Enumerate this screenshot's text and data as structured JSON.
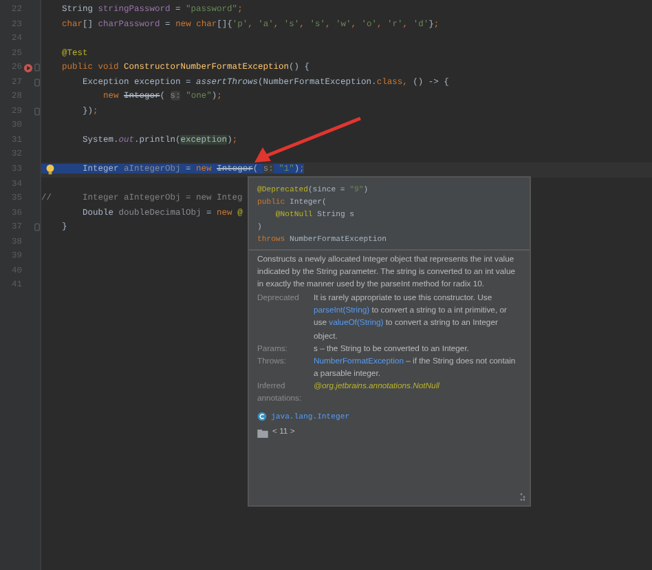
{
  "editor": {
    "lines": [
      {
        "number": "22",
        "selected": false,
        "fold": false,
        "run_icon": false,
        "bulb_icon": false,
        "tokens": [
          {
            "kind": "plain",
            "text": "    String "
          },
          {
            "kind": "field",
            "text": "stringPassword"
          },
          {
            "kind": "plain",
            "text": " = "
          },
          {
            "kind": "str",
            "text": "\"password\""
          },
          {
            "kind": "kw",
            "text": ";"
          }
        ]
      },
      {
        "number": "23",
        "selected": false,
        "fold": false,
        "run_icon": false,
        "bulb_icon": false,
        "tokens": [
          {
            "kind": "kw",
            "text": "    char"
          },
          {
            "kind": "plain",
            "text": "[] "
          },
          {
            "kind": "field",
            "text": "charPassword"
          },
          {
            "kind": "plain",
            "text": " = "
          },
          {
            "kind": "kw",
            "text": "new char"
          },
          {
            "kind": "plain",
            "text": "[]{"
          },
          {
            "kind": "str",
            "text": "'p'"
          },
          {
            "kind": "kw",
            "text": ", "
          },
          {
            "kind": "str",
            "text": "'a'"
          },
          {
            "kind": "kw",
            "text": ", "
          },
          {
            "kind": "str",
            "text": "'s'"
          },
          {
            "kind": "kw",
            "text": ", "
          },
          {
            "kind": "str",
            "text": "'s'"
          },
          {
            "kind": "kw",
            "text": ", "
          },
          {
            "kind": "str",
            "text": "'w'"
          },
          {
            "kind": "kw",
            "text": ", "
          },
          {
            "kind": "str",
            "text": "'o'"
          },
          {
            "kind": "kw",
            "text": ", "
          },
          {
            "kind": "str",
            "text": "'r'"
          },
          {
            "kind": "kw",
            "text": ", "
          },
          {
            "kind": "str",
            "text": "'d'"
          },
          {
            "kind": "plain",
            "text": "}"
          },
          {
            "kind": "kw",
            "text": ";"
          }
        ]
      },
      {
        "number": "24",
        "selected": false,
        "fold": false,
        "run_icon": false,
        "bulb_icon": false
      },
      {
        "number": "25",
        "selected": false,
        "fold": false,
        "run_icon": false,
        "bulb_icon": false,
        "tokens": [
          {
            "kind": "ann",
            "text": "    @Test"
          }
        ]
      },
      {
        "number": "26",
        "selected": false,
        "fold": true,
        "run_icon": true,
        "bulb_icon": false,
        "tokens": [
          {
            "kind": "kw",
            "text": "    public void "
          },
          {
            "kind": "decl",
            "text": "ConstructorNumberFormatException"
          },
          {
            "kind": "plain",
            "text": "() {"
          }
        ]
      },
      {
        "number": "27",
        "selected": false,
        "fold": true,
        "run_icon": false,
        "bulb_icon": false,
        "tokens": [
          {
            "kind": "plain",
            "text": "        Exception exception = "
          },
          {
            "kind": "italic",
            "text": "assertThrows"
          },
          {
            "kind": "plain",
            "text": "(NumberFormatException."
          },
          {
            "kind": "kw",
            "text": "class, "
          },
          {
            "kind": "plain",
            "text": "() -> {"
          }
        ]
      },
      {
        "number": "28",
        "selected": false,
        "fold": false,
        "run_icon": false,
        "bulb_icon": false,
        "tokens": [
          {
            "kind": "kw",
            "text": "            new "
          },
          {
            "kind": "deprecated",
            "text": "Integer"
          },
          {
            "kind": "plain",
            "text": "( "
          },
          {
            "kind": "hint",
            "text": "s:"
          },
          {
            "kind": "str",
            "text": " \"one\""
          },
          {
            "kind": "plain",
            "text": ")"
          },
          {
            "kind": "kw",
            "text": ";"
          }
        ]
      },
      {
        "number": "29",
        "selected": false,
        "fold": true,
        "run_icon": false,
        "bulb_icon": false,
        "tokens": [
          {
            "kind": "plain",
            "text": "        })"
          },
          {
            "kind": "kw",
            "text": ";"
          }
        ]
      },
      {
        "number": "30",
        "selected": false,
        "fold": false,
        "run_icon": false,
        "bulb_icon": false
      },
      {
        "number": "31",
        "selected": false,
        "fold": false,
        "run_icon": false,
        "bulb_icon": false,
        "tokens": [
          {
            "kind": "plain",
            "text": "        System."
          },
          {
            "kind": "static",
            "text": "out"
          },
          {
            "kind": "plain",
            "text": ".println("
          },
          {
            "kind": "usage",
            "text": "exception"
          },
          {
            "kind": "plain",
            "text": ")"
          },
          {
            "kind": "kw",
            "text": ";"
          }
        ]
      },
      {
        "number": "32",
        "selected": false,
        "fold": false,
        "run_icon": false,
        "bulb_icon": false
      },
      {
        "number": "33",
        "selected": true,
        "fold": false,
        "run_icon": false,
        "bulb_icon": true,
        "tokens": [
          {
            "kind": "plain",
            "text": "        Integer "
          },
          {
            "kind": "unused",
            "text": "aIntegerObj"
          },
          {
            "kind": "plain",
            "text": " = "
          },
          {
            "kind": "kw",
            "text": "new "
          },
          {
            "kind": "deprecated",
            "text": "Integer"
          },
          {
            "kind": "plain",
            "text": "( "
          },
          {
            "kind": "hint",
            "text": "s:"
          },
          {
            "kind": "str",
            "text": " \"1\""
          },
          {
            "kind": "plain",
            "text": ")"
          },
          {
            "kind": "kw",
            "text": ";"
          }
        ]
      },
      {
        "number": "34",
        "selected": false,
        "fold": false,
        "run_icon": false,
        "bulb_icon": false
      },
      {
        "number": "35",
        "selected": false,
        "fold": false,
        "run_icon": false,
        "bulb_icon": false,
        "tokens": [
          {
            "kind": "comment",
            "text": "//      Integer aIntegerObj = new Integ"
          }
        ]
      },
      {
        "number": "36",
        "selected": false,
        "fold": false,
        "run_icon": false,
        "bulb_icon": false,
        "tokens": [
          {
            "kind": "plain",
            "text": "        Double "
          },
          {
            "kind": "unused",
            "text": "doubleDecimalObj"
          },
          {
            "kind": "plain",
            "text": " = "
          },
          {
            "kind": "kw",
            "text": "new "
          },
          {
            "kind": "ann",
            "text": "@"
          }
        ]
      },
      {
        "number": "37",
        "selected": false,
        "fold": true,
        "run_icon": false,
        "bulb_icon": false,
        "tokens": [
          {
            "kind": "plain",
            "text": "    }"
          }
        ]
      },
      {
        "number": "38",
        "selected": false,
        "fold": false,
        "run_icon": false,
        "bulb_icon": false
      },
      {
        "number": "39",
        "selected": false,
        "fold": false,
        "run_icon": false,
        "bulb_icon": false
      },
      {
        "number": "40",
        "selected": false,
        "fold": false,
        "run_icon": false,
        "bulb_icon": false
      },
      {
        "number": "41",
        "selected": false,
        "fold": false,
        "run_icon": false,
        "bulb_icon": false
      }
    ]
  },
  "doc_popup": {
    "signature": [
      [
        {
          "kind": "ann",
          "text": "@Deprecated"
        },
        {
          "kind": "plain",
          "text": "(since = "
        },
        {
          "kind": "str",
          "text": "\"9\""
        },
        {
          "kind": "plain",
          "text": ")"
        }
      ],
      [
        {
          "kind": "kw",
          "text": "public "
        },
        {
          "kind": "plain",
          "text": "Integer("
        }
      ],
      [
        {
          "kind": "ann",
          "text": "    @NotNull"
        },
        {
          "kind": "plain",
          "text": " String s"
        }
      ],
      [
        {
          "kind": "plain",
          "text": ")"
        }
      ],
      [
        {
          "kind": "kw",
          "text": "throws "
        },
        {
          "kind": "plain",
          "text": "NumberFormatException"
        }
      ]
    ],
    "description": "Constructs a newly allocated Integer object that represents the int value indicated by the String parameter. The string is converted to an int value in exactly the manner used by the parseInt method for radix 10.",
    "sections": [
      {
        "label": "Deprecated",
        "parts": [
          {
            "kind": "text",
            "text": "It is rarely appropriate to use this constructor. Use "
          },
          {
            "kind": "link",
            "text": "parseInt(String)"
          },
          {
            "kind": "text",
            "text": " to convert a string to a int primitive, or use "
          },
          {
            "kind": "link",
            "text": "valueOf(String)"
          },
          {
            "kind": "text",
            "text": " to convert a string to an Integer object."
          }
        ]
      },
      {
        "label": "Params:",
        "parts": [
          {
            "kind": "text",
            "text": "s – the String to be converted to an Integer."
          }
        ]
      },
      {
        "label": "Throws:",
        "parts": [
          {
            "kind": "link",
            "text": "NumberFormatException"
          },
          {
            "kind": "text",
            "text": " – if the String does not contain a parsable integer."
          }
        ]
      },
      {
        "label": "Inferred annotations:",
        "parts": [
          {
            "kind": "annotation",
            "text": "@org.jetbrains.annotations.NotNull"
          }
        ]
      }
    ],
    "class_name": "java.lang.Integer",
    "library": "< 11 >"
  }
}
